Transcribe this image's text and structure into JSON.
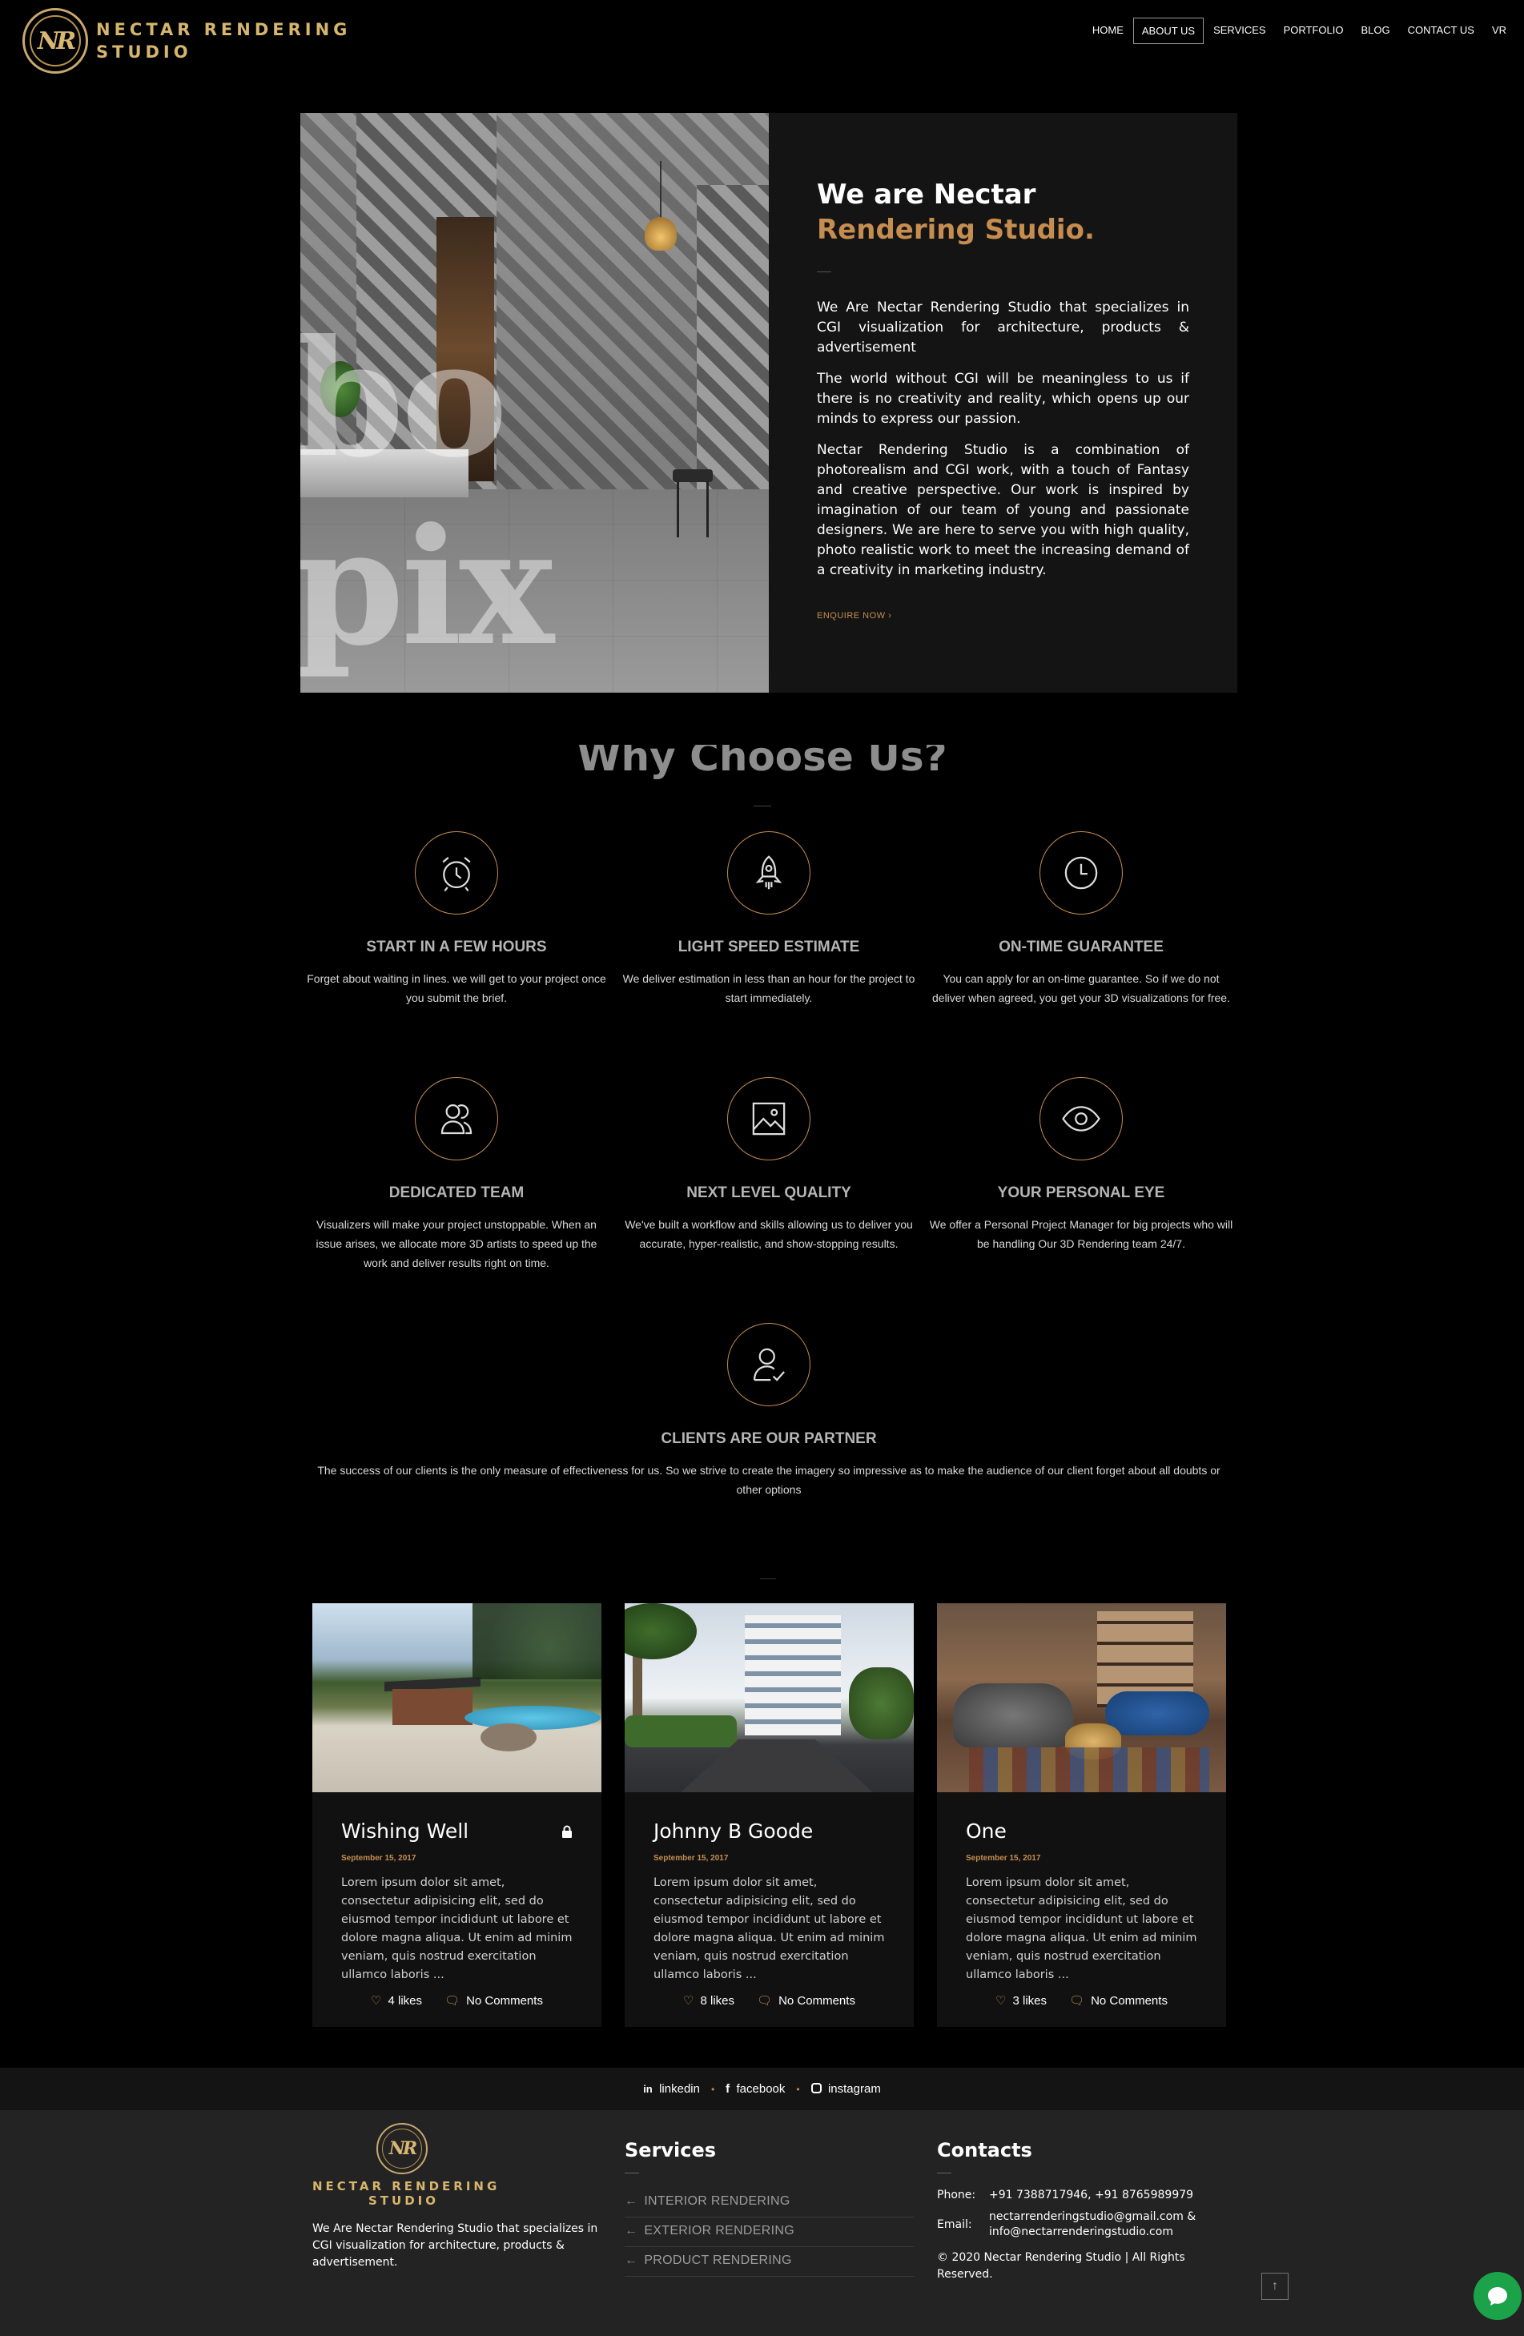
{
  "brand": {
    "line1": "NECTAR RENDERING",
    "line2": "STUDIO",
    "monogram": "NR",
    "gold": "#d6b56d",
    "accent": "#c58d4f"
  },
  "nav": {
    "items": [
      {
        "label": "HOME"
      },
      {
        "label": "ABOUT US",
        "active": true
      },
      {
        "label": "SERVICES"
      },
      {
        "label": "PORTFOLIO"
      },
      {
        "label": "BLOG"
      },
      {
        "label": "CONTACT US"
      },
      {
        "label": "VR"
      }
    ]
  },
  "about": {
    "title_line1": "We are Nectar",
    "title_line2": "Rendering Studio.",
    "image_overlay_text": "bo pix",
    "paragraphs": [
      "We Are Nectar Rendering Studio that specializes in CGI visualization for architecture, products & advertisement",
      "The world without CGI will be meaningless to us if there is no creativity and reality, which opens up our minds to express our passion.",
      "Nectar Rendering Studio is a combination of photorealism and CGI work, with a touch of Fantasy and creative perspective. Our work is inspired by imagination of our team of young and passionate designers. We are here to serve you with high quality, photo realistic work to meet the increasing demand of a creativity in marketing industry."
    ],
    "cta": "ENQUIRE NOW"
  },
  "why": {
    "title": "Why Choose Us?",
    "features": [
      {
        "icon": "alarm-clock-icon",
        "title": "START IN A FEW HOURS",
        "text": "Forget about waiting in lines. we will get to your project once you submit the brief."
      },
      {
        "icon": "rocket-icon",
        "title": "LIGHT SPEED ESTIMATE",
        "text": "We deliver estimation in less than an hour for the project to start immediately."
      },
      {
        "icon": "clock-icon",
        "title": "ON-TIME GUARANTEE",
        "text": "You can apply for an on-time guarantee. So if we do not deliver when agreed, you get your 3D visualizations for free."
      },
      {
        "icon": "team-icon",
        "title": "DEDICATED TEAM",
        "text": "Visualizers will make your project unstoppable. When an issue arises, we allocate more 3D artists to speed up the work and deliver results right on time."
      },
      {
        "icon": "image-icon",
        "title": "NEXT LEVEL QUALITY",
        "text": "We've built a workflow and skills allowing us to deliver you accurate, hyper-realistic, and show-stopping results."
      },
      {
        "icon": "eye-icon",
        "title": "YOUR PERSONAL EYE",
        "text": "We offer a Personal Project Manager for big projects who will be handling Our 3D Rendering team 24/7."
      },
      {
        "icon": "user-check-icon",
        "title": "CLIENTS ARE OUR PARTNER",
        "text": "The success of our clients is the only measure of effectiveness for us. So we strive to create the imagery so impressive as to make the audience of our client forget about all doubts or other options"
      }
    ]
  },
  "posts": [
    {
      "title": "Wishing Well",
      "date": "September 15, 2017",
      "excerpt": "Lorem ipsum dolor sit amet, consectetur adipisicing elit, sed do eiusmod tempor incididunt ut labore et dolore magna aliqua. Ut enim ad minim veniam, quis nostrud exercitation ullamco laboris ...",
      "likes": "4 likes",
      "comments": "No Comments",
      "locked": true
    },
    {
      "title": "Johnny B Goode",
      "date": "September 15, 2017",
      "excerpt": "Lorem ipsum dolor sit amet, consectetur adipisicing elit, sed do eiusmod tempor incididunt ut labore et dolore magna aliqua. Ut enim ad minim veniam, quis nostrud exercitation ullamco laboris ...",
      "likes": "8 likes",
      "comments": "No Comments"
    },
    {
      "title": "One",
      "date": "September 15, 2017",
      "excerpt": "Lorem ipsum dolor sit amet, consectetur adipisicing elit, sed do eiusmod tempor incididunt ut labore et dolore magna aliqua. Ut enim ad minim veniam, quis nostrud exercitation ullamco laboris ...",
      "likes": "3 likes",
      "comments": "No Comments"
    }
  ],
  "social": {
    "linkedin": "linkedin",
    "facebook": "facebook",
    "instagram": "instagram"
  },
  "footer": {
    "about": "We Are Nectar Rendering Studio that specializes in CGI visualization for architecture, products & advertisement.",
    "services_title": "Services",
    "services": [
      "INTERIOR RENDERING",
      "EXTERIOR RENDERING",
      "PRODUCT RENDERING"
    ],
    "contacts_title": "Contacts",
    "phone_label": "Phone:",
    "phone": "+91 7388717946, +91 8765989979",
    "email_label": "Email:",
    "email1": "nectarrenderingstudio@gmail.com &",
    "email2": "info@nectarrenderingstudio.com",
    "copyright": "© 2020 Nectar Rendering Studio | All Rights Reserved."
  }
}
